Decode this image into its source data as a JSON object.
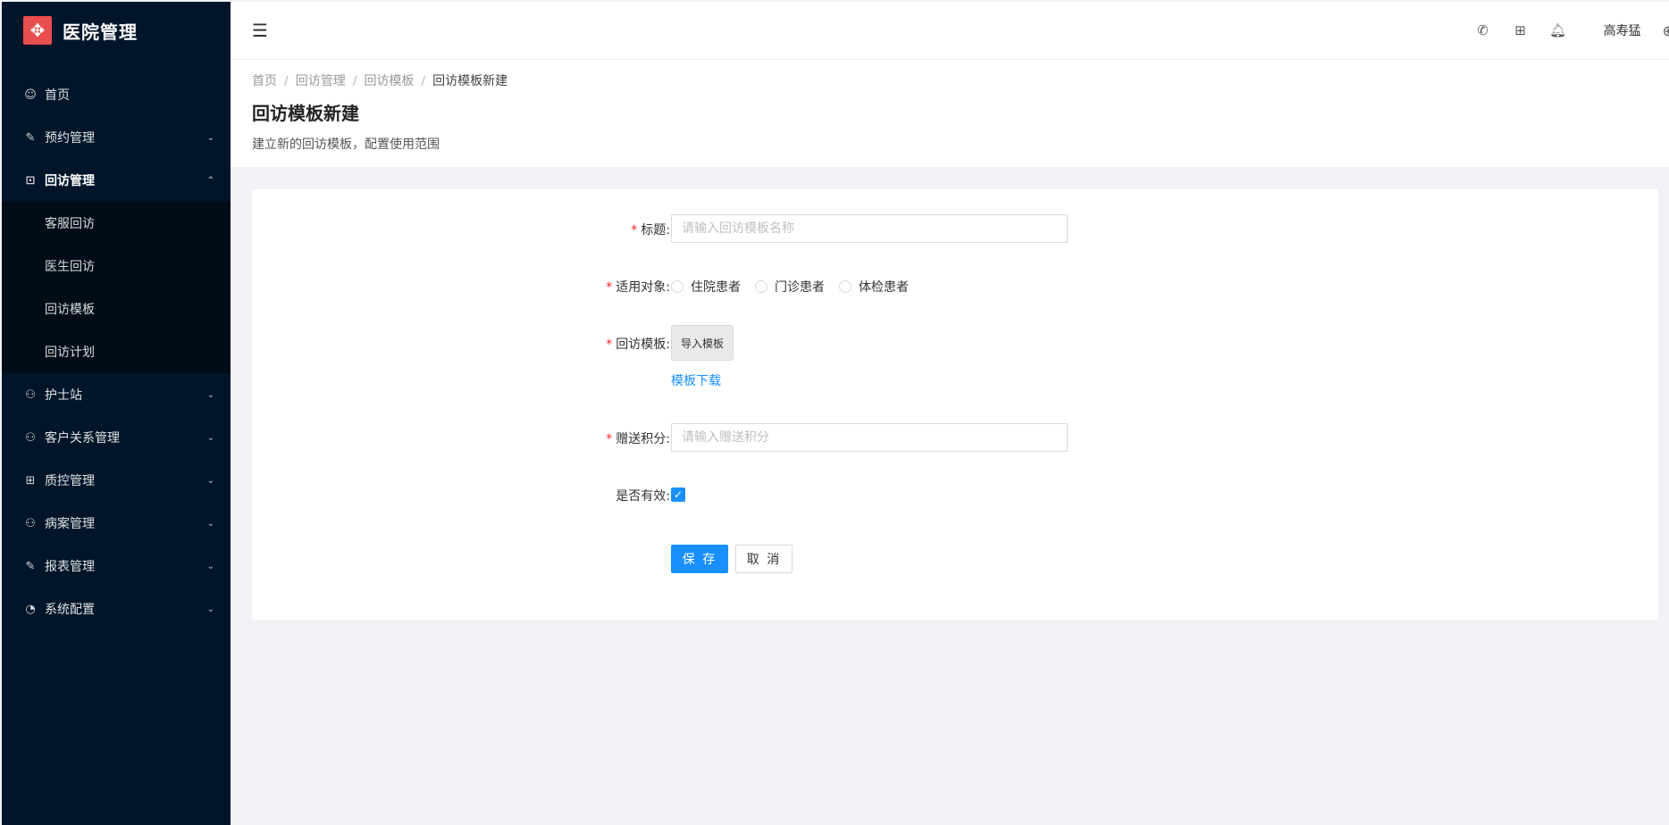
{
  "app": {
    "title": "医院管理"
  },
  "sidebar": {
    "items": [
      {
        "label": "首页",
        "icon": "smile-icon"
      },
      {
        "label": "预约管理",
        "icon": "edit-icon"
      },
      {
        "label": "回访管理",
        "icon": "lock-icon"
      },
      {
        "label": "护士站",
        "icon": "user-icon"
      },
      {
        "label": "客户关系管理",
        "icon": "user-icon"
      },
      {
        "label": "质控管理",
        "icon": "table-icon"
      },
      {
        "label": "病案管理",
        "icon": "user-icon"
      },
      {
        "label": "报表管理",
        "icon": "edit-icon"
      },
      {
        "label": "系统配置",
        "icon": "dashboard-icon"
      }
    ],
    "submenu": [
      "客服回访",
      "医生回访",
      "回访模板",
      "回访计划"
    ]
  },
  "header": {
    "username": "高寿猛"
  },
  "breadcrumb": [
    "首页",
    "回访管理",
    "回访模板",
    "回访模板新建"
  ],
  "page": {
    "title": "回访模板新建",
    "description": "建立新的回访模板，配置使用范围"
  },
  "form": {
    "title_label": "标题:",
    "title_placeholder": "请输入回访模板名称",
    "target_label": "适用对象:",
    "target_options": [
      "住院患者",
      "门诊患者",
      "体检患者"
    ],
    "template_label": "回访模板:",
    "import_button": "导入模板",
    "download_link": "模板下载",
    "points_label": "赠送积分:",
    "points_placeholder": "请输入赠送积分",
    "valid_label": "是否有效:",
    "valid_checked": true,
    "save_button": "保 存",
    "cancel_button": "取 消"
  },
  "colors": {
    "sidebar_bg": "#001529",
    "primary": "#1890ff",
    "logo": "#e94e4e",
    "required": "#f5222d"
  }
}
